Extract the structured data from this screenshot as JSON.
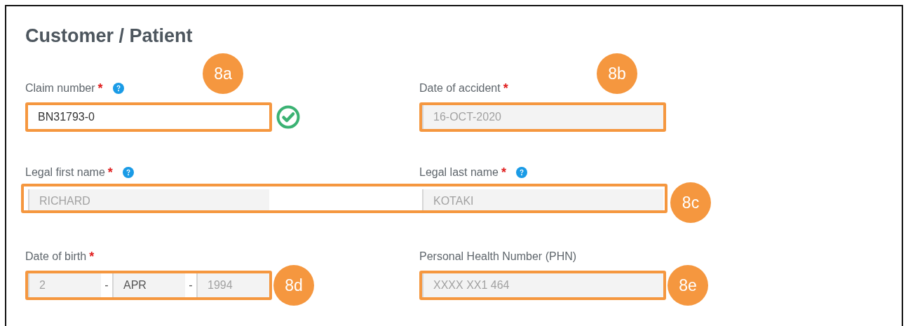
{
  "title": "Customer / Patient",
  "rows": [
    {
      "fields": [
        {
          "label": "Claim number",
          "required_mark": "*",
          "help": true,
          "kind": "text",
          "value": "BN31793-0",
          "disabled": false,
          "valid": true,
          "callout": {
            "label": "8a",
            "kind": "top"
          }
        },
        {
          "label": "Date of accident",
          "required_mark": "*",
          "kind": "text",
          "value": "16-OCT-2020",
          "disabled": true,
          "callout": {
            "label": "8b",
            "kind": "top"
          }
        }
      ]
    },
    {
      "callout": "8c",
      "fields": [
        {
          "label": "Legal first name",
          "required_mark": "*",
          "help": true,
          "kind": "text",
          "value": "RICHARD",
          "disabled": true
        },
        {
          "label": "Legal last name",
          "required_mark": "*",
          "help": true,
          "kind": "text",
          "value": "KOTAKI",
          "disabled": true
        }
      ]
    },
    {
      "fields": [
        {
          "label": "Date of birth",
          "required_mark": "*",
          "kind": "parts",
          "disabled": true,
          "callout": {
            "label": "8d",
            "kind": "right"
          },
          "parts": [
            {
              "kind": "text",
              "value": "2"
            },
            {
              "kind": "separator",
              "value": "-"
            },
            {
              "kind": "select",
              "value": "APR"
            },
            {
              "kind": "separator",
              "value": "-"
            },
            {
              "kind": "text",
              "value": "1994"
            }
          ]
        },
        {
          "label": "Personal Health Number (PHN)",
          "kind": "text",
          "value": "XXXX XX1 464",
          "disabled": true,
          "callout": {
            "label": "8e",
            "kind": "right"
          }
        }
      ]
    }
  ]
}
